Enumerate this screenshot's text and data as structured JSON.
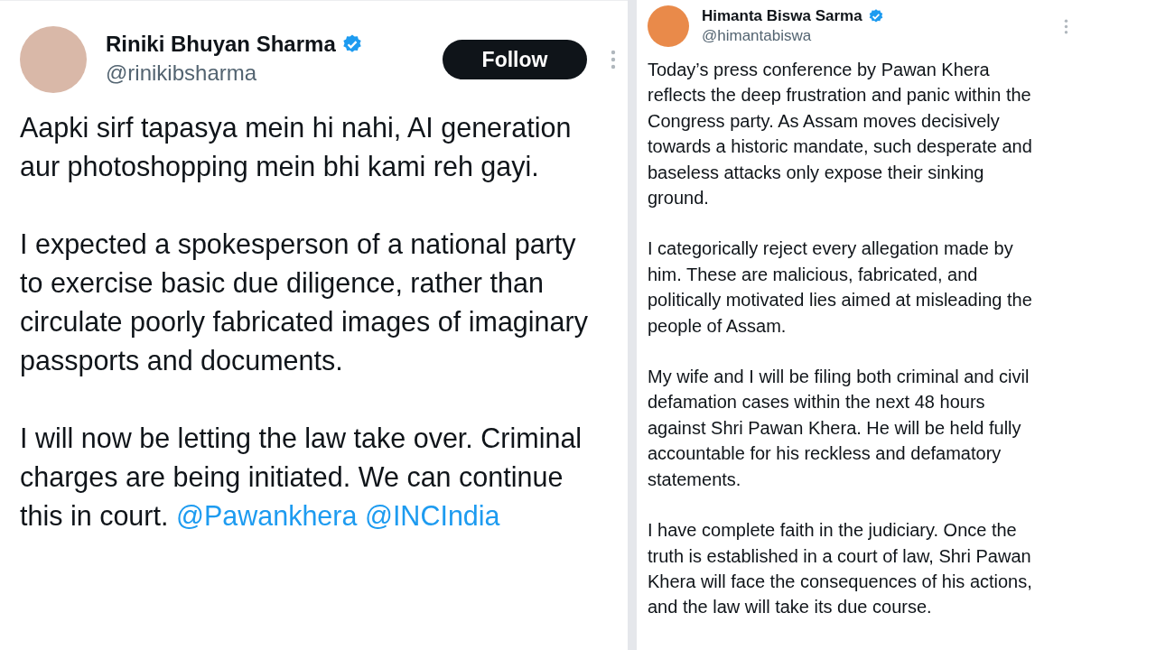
{
  "tweets": [
    {
      "author": {
        "name": "Riniki Bhuyan Sharma",
        "handle": "@rinikibsharma",
        "verified": true
      },
      "follow_button": "Follow",
      "paragraphs": [
        {
          "text": "Aapki sirf tapasya mein hi nahi, AI generation aur photoshopping mein bhi kami reh gayi."
        },
        {
          "text": "I expected a spokesperson of a national party to exercise basic due diligence, rather than circulate poorly fabricated images of imaginary passports and documents."
        },
        {
          "text": "I will now be letting the law take over. Criminal charges are being initiated. We can continue this in court.",
          "mentions": [
            "@Pawankhera",
            "@INCIndia"
          ]
        }
      ]
    },
    {
      "author": {
        "name": "Himanta Biswa Sarma",
        "handle": "@himantabiswa",
        "verified": true
      },
      "paragraphs": [
        {
          "text": "Today’s press conference by Pawan Khera reflects the deep frustration and panic within the Congress party. As Assam moves decisively towards a historic mandate, such desperate and baseless attacks only expose their sinking ground."
        },
        {
          "text": "I categorically reject every allegation made by him. These are malicious, fabricated, and politically motivated lies aimed at misleading the people of Assam."
        },
        {
          "text": "My wife and I will be filing both criminal and civil defamation cases within the next 48 hours against Shri Pawan Khera. He will be held fully accountable for his reckless and defamatory statements."
        },
        {
          "text": "I have complete faith in the judiciary. Once the truth is established in a court of law, Shri Pawan Khera will face the consequences of his actions, and the law will take its due course."
        }
      ]
    }
  ]
}
